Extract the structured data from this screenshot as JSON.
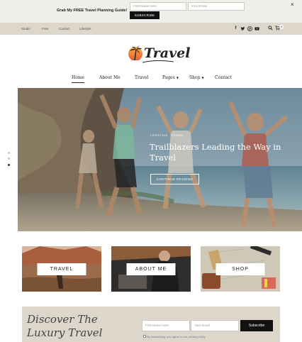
{
  "promo": {
    "text": "Grab My FREE Travel Planning Guide!",
    "first_name_placeholder": "First Name Here",
    "email_placeholder": "Your Email",
    "button_label": "SUBSCRIBE",
    "close_label": "×"
  },
  "topbar": {
    "links": [
      "Studio",
      "Free",
      "Contact",
      "Lifestyle"
    ],
    "social_icons": [
      "facebook-icon",
      "twitter-icon",
      "pinterest-icon",
      "youtube-icon"
    ],
    "cart_count": "0"
  },
  "logo": {
    "text": "Travel"
  },
  "nav": {
    "items": [
      {
        "label": "Home",
        "active": true,
        "dropdown": false
      },
      {
        "label": "About Me",
        "active": false,
        "dropdown": false
      },
      {
        "label": "Travel",
        "active": false,
        "dropdown": false
      },
      {
        "label": "Pages",
        "active": false,
        "dropdown": true
      },
      {
        "label": "Shop",
        "active": false,
        "dropdown": true
      },
      {
        "label": "Contact",
        "active": false,
        "dropdown": false
      }
    ]
  },
  "hero": {
    "tags": "LIFESTYLE · TRAVEL",
    "title": "Trailblazers Leading the Way in Travel",
    "button_label": "CONTINUE READING",
    "slide_count": 3,
    "active_slide": 3
  },
  "cards": [
    {
      "label": "TRAVEL"
    },
    {
      "label": "ABOUT ME"
    },
    {
      "label": "SHOP"
    }
  ],
  "subscribe": {
    "title_line1": "Discover The",
    "title_line2": "Luxury Travel",
    "first_name_placeholder": "First Name Here",
    "email_placeholder": "Your Email",
    "button_label": "Subscribe",
    "consent": "By subscribing, you agree to our privacy policy"
  },
  "colors": {
    "promo_bg": "#f1efeb",
    "topbar_bg": "#ddd6cb",
    "subscribe_bg": "#ddd6cb",
    "button_dark": "#111111",
    "logo_sun": "#f28c3a"
  }
}
